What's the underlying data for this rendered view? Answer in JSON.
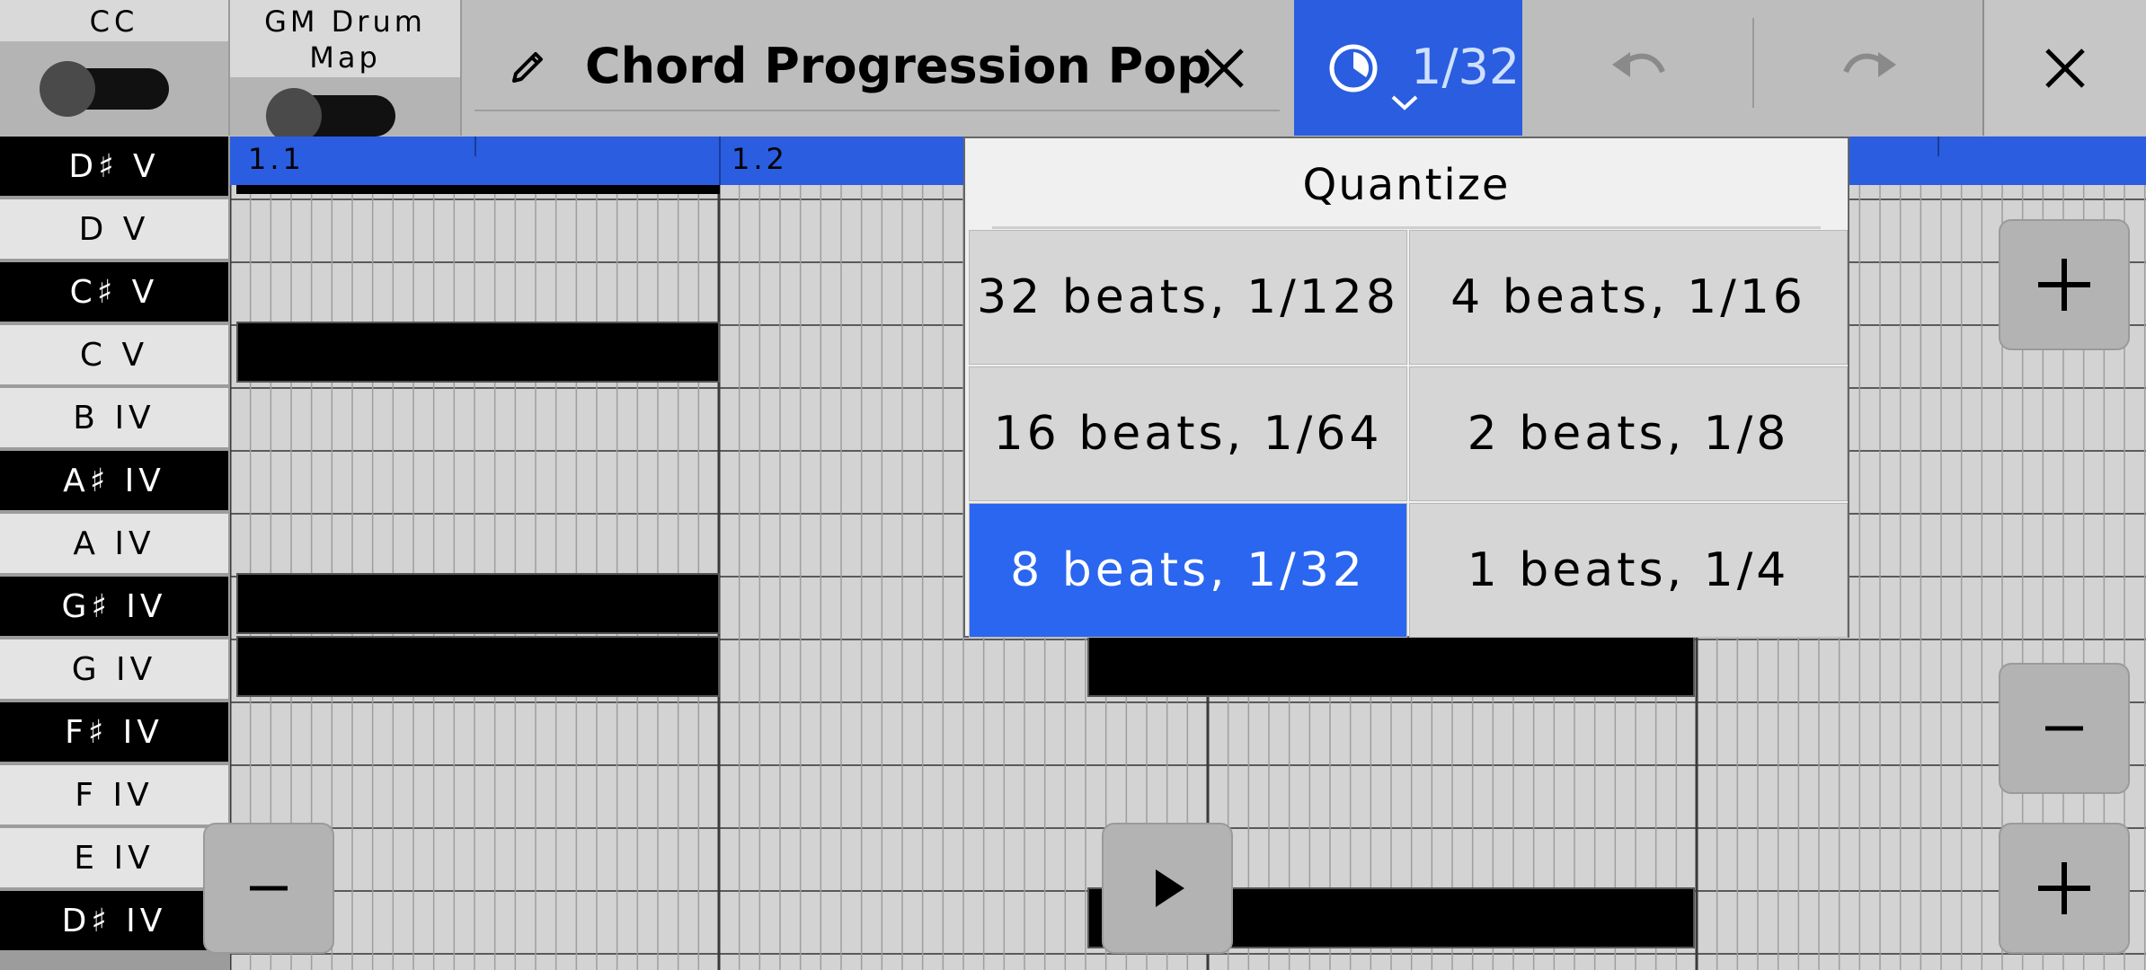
{
  "toolbar": {
    "cc_label": "CC",
    "gm_label": "GM Drum Map",
    "song_title": "Chord Progression Pop",
    "quantize_value": "1/32"
  },
  "piano_keys": [
    {
      "label": "D♯ V",
      "color": "black"
    },
    {
      "label": "D V",
      "color": "white"
    },
    {
      "label": "C♯ V",
      "color": "black"
    },
    {
      "label": "C V",
      "color": "white"
    },
    {
      "label": "B IV",
      "color": "white"
    },
    {
      "label": "A♯ IV",
      "color": "black"
    },
    {
      "label": "A IV",
      "color": "white"
    },
    {
      "label": "G♯ IV",
      "color": "black"
    },
    {
      "label": "G IV",
      "color": "white"
    },
    {
      "label": "F♯ IV",
      "color": "black"
    },
    {
      "label": "F IV",
      "color": "white"
    },
    {
      "label": "E IV",
      "color": "white"
    },
    {
      "label": "D♯ IV",
      "color": "black"
    }
  ],
  "ruler": {
    "bars": [
      "1.1",
      "1.2"
    ]
  },
  "quantize_popup": {
    "title": "Quantize",
    "options": [
      "32 beats, 1/128",
      "4 beats, 1/16",
      "16 beats, 1/64",
      "2 beats, 1/8",
      "8 beats, 1/32",
      "1 beats, 1/4"
    ],
    "selected": "8 beats, 1/32"
  },
  "colors": {
    "accent": "#2a5de0",
    "selected_option": "#2a66ef",
    "background": "#bdbdbd",
    "note": "#000000"
  },
  "icons": {
    "pencil": "pencil-icon",
    "clear_title": "close-icon",
    "quantize": "clock-icon",
    "undo": "undo-icon",
    "redo": "redo-icon",
    "close": "close-icon",
    "zoom_in": "plus-icon",
    "zoom_out": "minus-icon",
    "play": "play-icon"
  }
}
